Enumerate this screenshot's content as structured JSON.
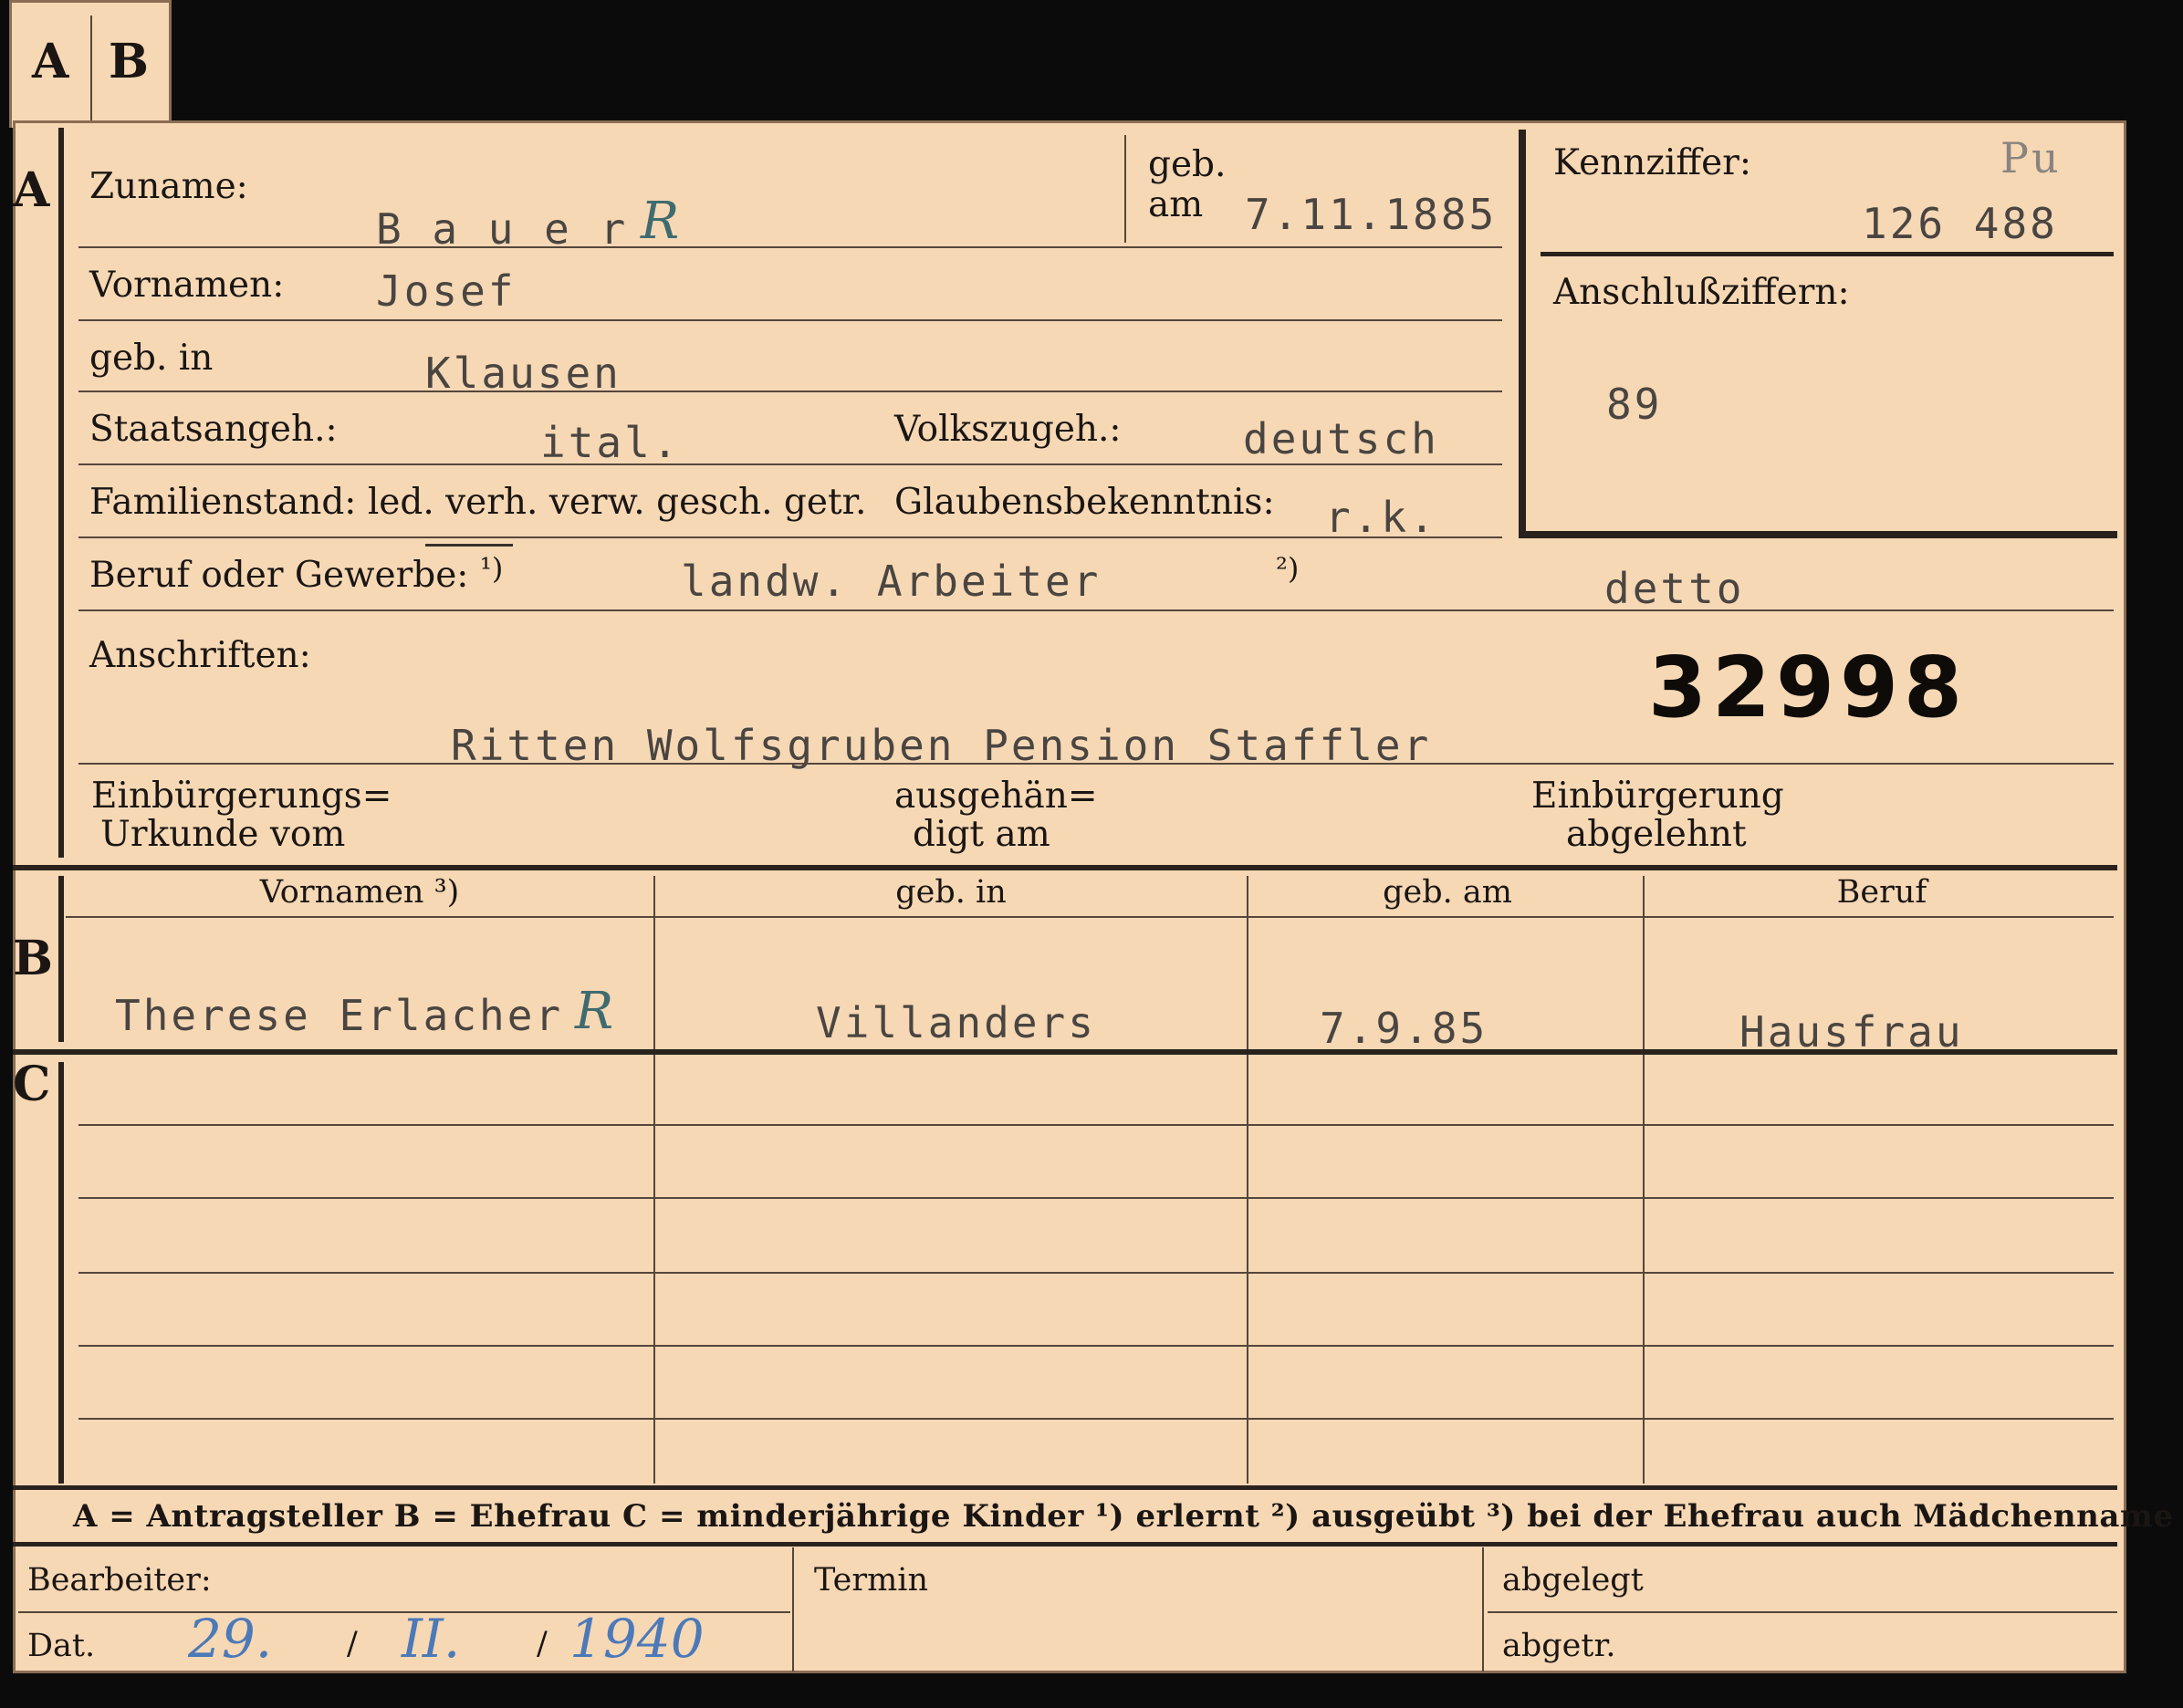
{
  "tabs": {
    "a": "A",
    "b": "B"
  },
  "sections": {
    "a": "A",
    "b": "B",
    "c": "C"
  },
  "labels": {
    "zuname": "Zuname:",
    "geb": "geb.",
    "am": "am",
    "kennziffer": "Kennziffer:",
    "vornamen": "Vornamen:",
    "anschlussziffern": "Anschlußziffern:",
    "geb_in": "geb. in",
    "staatsangeh": "Staatsangeh.:",
    "volkszugeh": "Volkszugeh.:",
    "familienstand": "Familienstand: led. verh. verw. gesch. getr.",
    "glaubensbekenntnis": "Glaubensbekenntnis:",
    "beruf": "Beruf oder Gewerbe:",
    "fn1": "¹)",
    "fn2": "²)",
    "anschriften": "Anschriften:",
    "einb_urkunde_1": "Einbürgerungs=",
    "einb_urkunde_2": "Urkunde vom",
    "ausgehaendigt_1": "ausgehän=",
    "ausgehaendigt_2": "digt am",
    "einb_abgelehnt_1": "Einbürgerung",
    "einb_abgelehnt_2": "abgelehnt"
  },
  "applicant": {
    "surname": "B a u e r",
    "birth_date": "7.11.1885",
    "kennziffer_code": "Pu",
    "kennziffer": "126 488",
    "given_names": "Josef",
    "anschlussziffern": "89",
    "birthplace": "Klausen",
    "citizenship": "ital.",
    "ethnicity": "deutsch",
    "religion": "r.k.",
    "occupation_learned": "landw. Arbeiter",
    "occupation_practiced": "detto",
    "card_number": "32998",
    "address": "Ritten Wolfsgruben Pension Staffler",
    "check_mark": "R"
  },
  "family_table": {
    "headers": [
      "Vornamen ³)",
      "geb. in",
      "geb. am",
      "Beruf"
    ],
    "spouse": {
      "given_names": "Therese Erlacher",
      "birthplace": "Villanders",
      "birth_date": "7.9.85",
      "occupation": "Hausfrau",
      "check_mark": "R"
    }
  },
  "legend": "A = Antragsteller   B = Ehefrau   C = minderjährige Kinder   ¹) erlernt   ²) ausgeübt   ³) bei der Ehefrau auch Mädchenname",
  "footer": {
    "bearbeiter": "Bearbeiter:",
    "dat": "Dat.",
    "termin": "Termin",
    "abgelegt": "abgelegt",
    "abgetr": "abgetr.",
    "date_day": "29.",
    "date_month": "II.",
    "date_year": "1940",
    "sep": "/"
  }
}
